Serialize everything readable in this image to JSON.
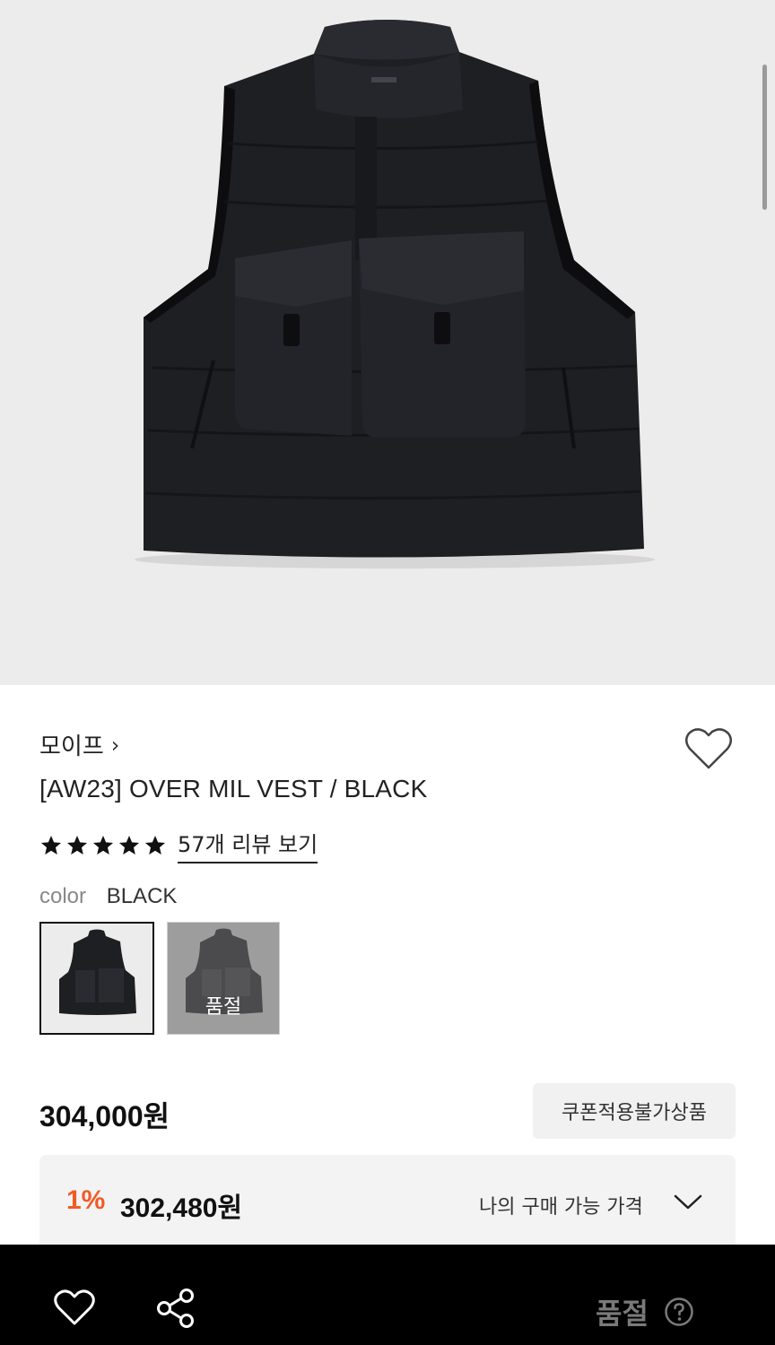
{
  "product": {
    "brand": "모이프",
    "brand_chevron": "›",
    "title": "[AW23] OVER MIL VEST / BLACK",
    "rating_stars": 5,
    "review_link": "57개 리뷰 보기",
    "color_label": "color",
    "color_value": "BLACK",
    "swatches": [
      {
        "name": "BLACK",
        "selected": true,
        "sold_out": false
      },
      {
        "name": "GRAY",
        "selected": false,
        "sold_out": true,
        "sold_out_label": "품절"
      }
    ],
    "price": "304,000",
    "price_unit": "원",
    "coupon_badge": "쿠폰적용불가상품",
    "discount": {
      "percent": "1%",
      "price": "302,480",
      "price_unit": "원",
      "label": "나의 구매 가능 가격"
    }
  },
  "bottom_bar": {
    "status": "품절",
    "icons": [
      "heart-icon",
      "share-icon",
      "help-icon"
    ]
  },
  "colors": {
    "accent": "#f15a24",
    "bottom_bar": "#000000",
    "hero_bg": "#ececec"
  }
}
